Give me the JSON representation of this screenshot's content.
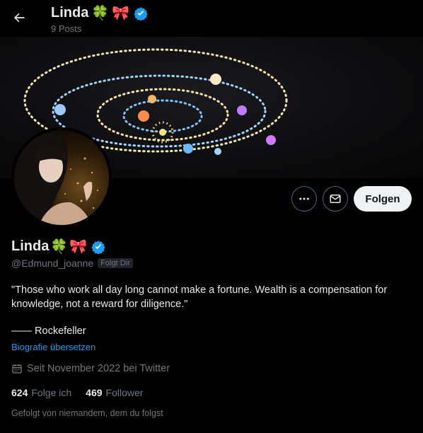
{
  "header": {
    "back_icon": "arrow-left-icon",
    "display_name": "Linda",
    "emoji_1": "🍀",
    "emoji_2": "🎀",
    "posts_count": "9 Posts"
  },
  "profile": {
    "display_name": "Linda",
    "emoji_1": "🍀",
    "emoji_2": "🎀",
    "verified_icon": "verified-badge-icon",
    "handle": "@Edmund_joanne",
    "follows_you_badge": "Folgt Dir",
    "bio_quote": "\"Those who work all day long cannot make a fortune. Wealth is a compensation for knowledge, not a reward for diligence.\"",
    "bio_signature": "—— Rockefeller",
    "translate_bio": "Biografie übersetzen",
    "joined": "Seit November 2022 bei Twitter",
    "following_count": "624",
    "following_label": "Folge ich",
    "followers_count": "469",
    "followers_label": "Follower",
    "followed_by": "Gefolgt von niemandem, dem du folgst"
  },
  "actions": {
    "more_icon": "more-dots-icon",
    "message_icon": "envelope-icon",
    "follow_label": "Folgen"
  },
  "colors": {
    "background": "#000000",
    "text_primary": "#e7e9ea",
    "text_secondary": "#71767b",
    "link": "#1d9bf0",
    "verified": "#1d9bf0",
    "follow_button": "#eff3f4"
  }
}
